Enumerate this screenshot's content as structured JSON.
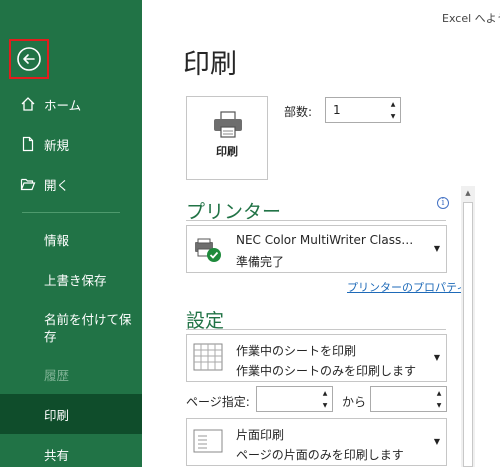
{
  "window": {
    "title": "Excel へよう"
  },
  "sidebar": {
    "items": [
      {
        "label": "ホーム"
      },
      {
        "label": "新規"
      },
      {
        "label": "開く"
      },
      {
        "label": "情報"
      },
      {
        "label": "上書き保存"
      },
      {
        "label": "名前を付けて保存"
      },
      {
        "label": "履歴"
      },
      {
        "label": "印刷"
      },
      {
        "label": "共有"
      }
    ]
  },
  "main": {
    "title": "印刷",
    "print_button": {
      "label": "印刷"
    },
    "copies": {
      "label": "部数:",
      "value": "1"
    },
    "printer": {
      "heading": "プリンター",
      "name": "NEC Color MultiWriter Class…",
      "status": "準備完了",
      "properties_link": "プリンターのプロパティ"
    },
    "settings": {
      "heading": "設定",
      "what_to_print": {
        "line1": "作業中のシートを印刷",
        "line2": "作業中のシートのみを印刷します"
      },
      "pages": {
        "label": "ページ指定:",
        "from_value": "",
        "to_label": "から",
        "to_value": ""
      },
      "sides": {
        "line1": "片面印刷",
        "line2": "ページの片面のみを印刷します"
      }
    }
  },
  "colors": {
    "accent": "#217346",
    "selected": "#0f4d2b",
    "link": "#1e6ab8",
    "highlight": "#e11d1d"
  }
}
